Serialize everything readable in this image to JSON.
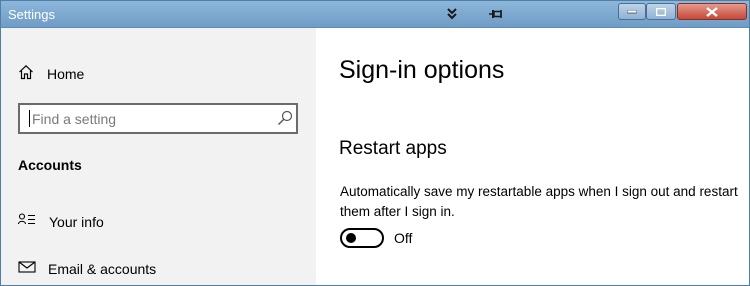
{
  "window": {
    "title": "Settings",
    "icons": [
      "pin-down-icon",
      "pushpin-icon",
      "minimize-icon",
      "maximize-icon",
      "close-icon"
    ]
  },
  "sidebar": {
    "home_label": "Home",
    "search": {
      "placeholder": "Find a setting",
      "value": ""
    },
    "section_heading": "Accounts",
    "items": [
      {
        "label": "Your info",
        "icon": "person-list-icon"
      },
      {
        "label": "Email & accounts",
        "icon": "mail-icon"
      }
    ]
  },
  "main": {
    "page_title": "Sign-in options",
    "section_title": "Restart apps",
    "description": "Automatically save my restartable apps when I sign out and restart them after I sign in.",
    "toggle": {
      "on": false,
      "state_label": "Off"
    }
  },
  "colors": {
    "titlebar": "#7fa9d0",
    "close_button": "#d4685b",
    "sidebar_bg": "#f2f2f2",
    "content_bg": "#ffffff"
  }
}
